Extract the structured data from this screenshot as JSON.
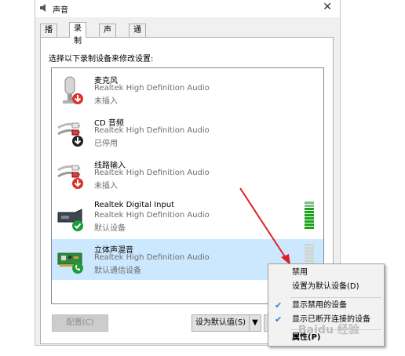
{
  "window": {
    "title": "声音",
    "close_glyph": "✕"
  },
  "tabs": [
    {
      "label": "播放",
      "active": false
    },
    {
      "label": "录制",
      "active": true
    },
    {
      "label": "声音",
      "active": false
    },
    {
      "label": "通信",
      "active": false
    }
  ],
  "instruction": "选择以下录制设备来修改设置:",
  "devices": [
    {
      "name": "麦克风",
      "driver": "Realtek High Definition Audio",
      "status": "未插入",
      "icon": "microphone-icon",
      "badge": "red-down-arrow",
      "selected": false
    },
    {
      "name": "CD 音频",
      "driver": "Realtek High Definition Audio",
      "status": "已停用",
      "icon": "audio-cable-icon",
      "badge": "black-down-arrow",
      "selected": false
    },
    {
      "name": "线路输入",
      "driver": "Realtek High Definition Audio",
      "status": "未插入",
      "icon": "audio-cable-icon",
      "badge": "red-down-arrow",
      "selected": false
    },
    {
      "name": "Realtek Digital Input",
      "driver": "Realtek High Definition Audio",
      "status": "默认设备",
      "icon": "digital-input-icon",
      "badge": "green-check",
      "selected": false,
      "level": 1.0
    },
    {
      "name": "立体声混音",
      "driver": "Realtek High Definition Audio",
      "status": "默认通信设备",
      "icon": "sound-card-icon",
      "badge": "green-phone",
      "selected": true,
      "level": 0.0
    }
  ],
  "buttons": {
    "configure": "配置(C)",
    "set_default": "设为默认值(S)",
    "dropdown_glyph": "▼"
  },
  "context_menu": {
    "items": [
      {
        "label": "禁用",
        "checked": false
      },
      {
        "label": "设置为默认设备(D)",
        "checked": false
      },
      {
        "label": "显示禁用的设备",
        "checked": true
      },
      {
        "label": "显示已断开连接的设备",
        "checked": true
      },
      {
        "label": "属性(P)",
        "checked": false,
        "bold": true
      }
    ],
    "check_glyph": "✔"
  },
  "colors": {
    "selection": "#cce8ff",
    "arrow": "#e02020",
    "meter_green": "#19a319",
    "check_blue": "#2d7fd8"
  },
  "watermark": "Baidu 经验"
}
